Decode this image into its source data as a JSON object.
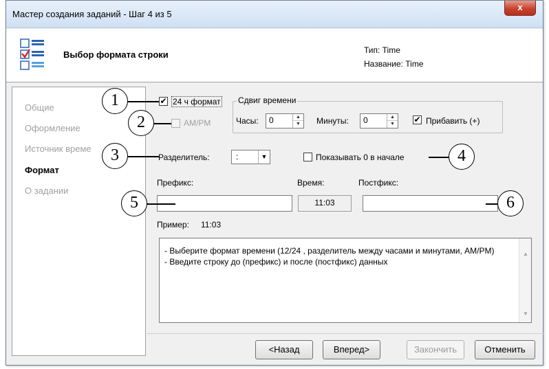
{
  "window": {
    "title": "Мастер создания заданий - Шаг 4 из 5",
    "close_label": "x"
  },
  "header": {
    "step_title": "Выбор формата строки",
    "type_line": "Тип: Time",
    "name_line": "Название: Time"
  },
  "sidebar": {
    "items": [
      {
        "label": "Общие",
        "active": false
      },
      {
        "label": "Оформление",
        "active": false
      },
      {
        "label": "Источник време",
        "active": false
      },
      {
        "label": "Формат",
        "active": true
      },
      {
        "label": "О задании",
        "active": false
      }
    ]
  },
  "format": {
    "format24": {
      "label": "24 ч формат",
      "checked": true,
      "mark": "✔"
    },
    "ampm": {
      "label": "AM/PM",
      "checked": false,
      "disabled": true
    },
    "time_shift": {
      "legend": "Сдвиг времени",
      "hours_label": "Часы:",
      "hours_value": "0",
      "minutes_label": "Минуты:",
      "minutes_value": "0",
      "add": {
        "label": "Прибавить (+)",
        "checked": true,
        "mark": "✔"
      }
    },
    "separator": {
      "label": "Разделитель:",
      "value": ":"
    },
    "leading_zero": {
      "label": "Показывать 0 в начале",
      "checked": false
    },
    "prefix": {
      "label": "Префикс:",
      "value": ""
    },
    "time": {
      "label": "Время:",
      "value": "11:03"
    },
    "postfix": {
      "label": "Постфикс:",
      "value": ""
    },
    "example": {
      "label": "Пример:",
      "value": "11:03"
    },
    "hint": "- Выберите формат времени (12/24 , разделитель между часами и минутами, AM/PM)\n- Введите строку до (префикс) и после (постфикс) данных"
  },
  "buttons": {
    "back": "<Назад",
    "next": "Вперед>",
    "finish": "Закончить",
    "cancel": "Отменить"
  },
  "callouts": [
    "1",
    "2",
    "3",
    "4",
    "5",
    "6"
  ],
  "icons": {
    "close": "close-icon",
    "wizard": "wizard-list-icon",
    "spin_up": "▲",
    "spin_down": "▼",
    "combo_arrow": "▼",
    "scroll_up": "▲",
    "scroll_down": "▼"
  },
  "colors": {
    "title_bar": "#cfe0f3",
    "close_button": "#c7432f",
    "disabled_text": "#a0a0a0"
  }
}
